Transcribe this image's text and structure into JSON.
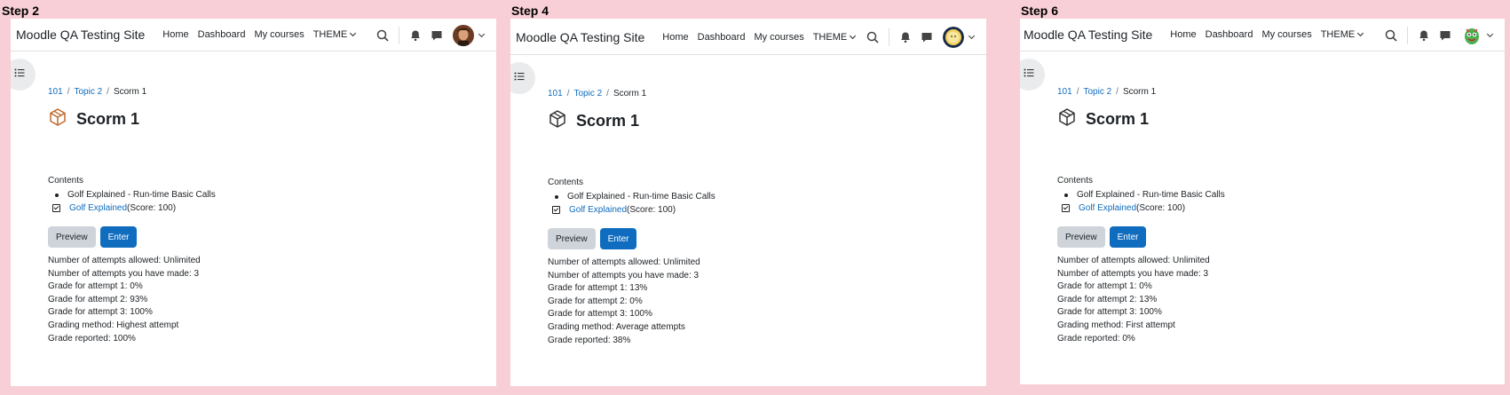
{
  "panels": [
    {
      "step_label": "Step 2",
      "site_name": "Moodle QA Testing Site",
      "nav": [
        "Home",
        "Dashboard",
        "My courses",
        "THEME"
      ],
      "avatar": "avatar-photo-man",
      "breadcrumb": {
        "course": "101",
        "section": "Topic 2",
        "current": "Scorm 1"
      },
      "title": "Scorm 1",
      "activity_icon_color": "#c2692a",
      "contents_label": "Contents",
      "toc_parent": "Golf Explained - Run-time Basic Calls",
      "toc_sco": "Golf Explained",
      "toc_score": "(Score: 100)",
      "preview_label": "Preview",
      "enter_label": "Enter",
      "info": [
        "Number of attempts allowed: Unlimited",
        "Number of attempts you have made: 3",
        "Grade for attempt 1: 0%",
        "Grade for attempt 2: 93%",
        "Grade for attempt 3: 100%",
        "Grading method: Highest attempt",
        "Grade reported: 100%"
      ]
    },
    {
      "step_label": "Step 4",
      "site_name": "Moodle QA Testing Site",
      "nav": [
        "Home",
        "Dashboard",
        "My courses",
        "THEME"
      ],
      "avatar": "avatar-badge-yellow",
      "breadcrumb": {
        "course": "101",
        "section": "Topic 2",
        "current": "Scorm 1"
      },
      "title": "Scorm 1",
      "activity_icon_color": "#333333",
      "contents_label": "Contents",
      "toc_parent": "Golf Explained - Run-time Basic Calls",
      "toc_sco": "Golf Explained",
      "toc_score": "(Score: 100)",
      "preview_label": "Preview",
      "enter_label": "Enter",
      "info": [
        "Number of attempts allowed: Unlimited",
        "Number of attempts you have made: 3",
        "Grade for attempt 1: 13%",
        "Grade for attempt 2: 0%",
        "Grade for attempt 3: 100%",
        "Grading method: Average attempts",
        "Grade reported: 38%"
      ]
    },
    {
      "step_label": "Step 6",
      "site_name": "Moodle QA Testing Site",
      "nav": [
        "Home",
        "Dashboard",
        "My courses",
        "THEME"
      ],
      "avatar": "avatar-cartoon-green",
      "breadcrumb": {
        "course": "101",
        "section": "Topic 2",
        "current": "Scorm 1"
      },
      "title": "Scorm 1",
      "activity_icon_color": "#333333",
      "contents_label": "Contents",
      "toc_parent": "Golf Explained - Run-time Basic Calls",
      "toc_sco": "Golf Explained",
      "toc_score": "(Score: 100)",
      "preview_label": "Preview",
      "enter_label": "Enter",
      "info": [
        "Number of attempts allowed: Unlimited",
        "Number of attempts you have made: 3",
        "Grade for attempt 1: 0%",
        "Grade for attempt 2: 13%",
        "Grade for attempt 3: 100%",
        "Grading method: First attempt",
        "Grade reported: 0%"
      ]
    }
  ],
  "colors": {
    "background": "#f8cfd6",
    "link": "#0f6cbf",
    "primary_button": "#0f6cbf",
    "secondary_button": "#ced4da"
  }
}
